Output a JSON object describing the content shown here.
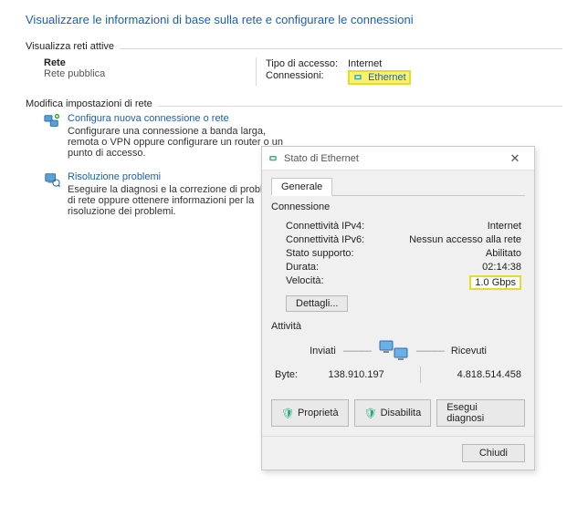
{
  "title": "Visualizzare le informazioni di base sulla rete e configurare le connessioni",
  "active": {
    "group_label": "Visualizza reti attive",
    "network_name": "Rete",
    "network_kind": "Rete pubblica",
    "access_label": "Tipo di accesso:",
    "access_value": "Internet",
    "conn_label": "Connessioni:",
    "conn_value": "Ethernet"
  },
  "modify": {
    "group_label": "Modifica impostazioni di rete",
    "item1_title": "Configura nuova connessione o rete",
    "item1_desc": "Configurare una connessione a banda larga, remota o VPN oppure configurare un router o un punto di accesso.",
    "item2_title": "Risoluzione problemi",
    "item2_desc": "Eseguire la diagnosi e la correzione di problemi di rete oppure ottenere informazioni per la risoluzione dei problemi."
  },
  "dialog": {
    "title": "Stato di Ethernet",
    "tab_general": "Generale",
    "sect_conn": "Connessione",
    "ipv4_label": "Connettività IPv4:",
    "ipv4_value": "Internet",
    "ipv6_label": "Connettività IPv6:",
    "ipv6_value": "Nessun accesso alla rete",
    "media_label": "Stato supporto:",
    "media_value": "Abilitato",
    "duration_label": "Durata:",
    "duration_value": "02:14:38",
    "speed_label": "Velocità:",
    "speed_value": "1.0 Gbps",
    "details_btn": "Dettagli...",
    "sect_activity": "Attività",
    "sent_label": "Inviati",
    "recv_label": "Ricevuti",
    "bytes_label": "Byte:",
    "bytes_sent": "138.910.197",
    "bytes_recv": "4.818.514.458",
    "btn_props": "Proprietà",
    "btn_disable": "Disabilita",
    "btn_diag": "Esegui diagnosi",
    "btn_close": "Chiudi"
  }
}
